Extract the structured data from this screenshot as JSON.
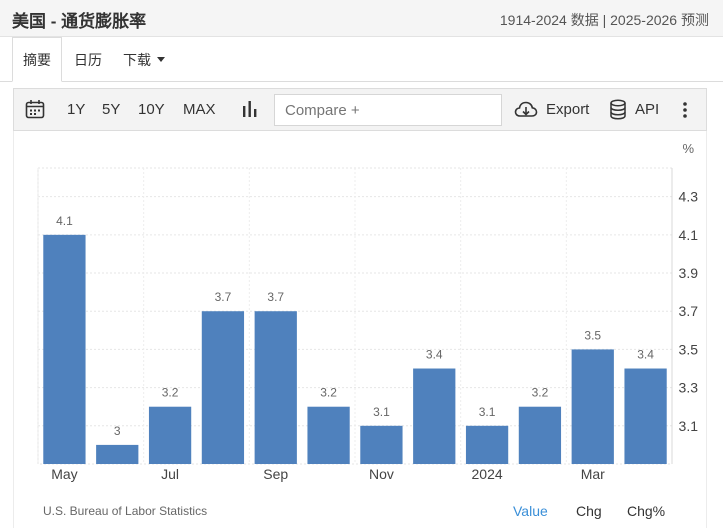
{
  "header": {
    "title": "美国 - 通货膨胀率",
    "range": "1914-2024 数据 | 2025-2026 预测"
  },
  "tabs": [
    {
      "label": "摘要",
      "active": true
    },
    {
      "label": "日历",
      "active": false
    },
    {
      "label": "下载",
      "active": false,
      "dropdown": true
    }
  ],
  "toolbar": {
    "periods": [
      "1Y",
      "5Y",
      "10Y",
      "MAX"
    ],
    "compare_placeholder": "Compare +",
    "export_label": "Export",
    "api_label": "API"
  },
  "chart_data": {
    "type": "bar",
    "unit_label": "%",
    "categories": [
      "2023-05",
      "2023-06",
      "2023-07",
      "2023-08",
      "2023-09",
      "2023-10",
      "2023-11",
      "2023-12",
      "2024-01",
      "2024-02",
      "2024-03",
      "2024-04"
    ],
    "values": [
      4.1,
      3.0,
      3.2,
      3.7,
      3.7,
      3.2,
      3.1,
      3.4,
      3.1,
      3.2,
      3.5,
      3.4
    ],
    "data_labels": [
      "4.1",
      "3",
      "3.2",
      "3.7",
      "3.7",
      "3.2",
      "3.1",
      "3.4",
      "3.1",
      "3.2",
      "3.5",
      "3.4"
    ],
    "x_tick_labels": [
      {
        "index": 0,
        "label": "May"
      },
      {
        "index": 2,
        "label": "Jul"
      },
      {
        "index": 4,
        "label": "Sep"
      },
      {
        "index": 6,
        "label": "Nov"
      },
      {
        "index": 8,
        "label": "2024"
      },
      {
        "index": 10,
        "label": "Mar"
      }
    ],
    "y_ticks": [
      3.1,
      3.3,
      3.5,
      3.7,
      3.9,
      4.1,
      4.3
    ],
    "y_tick_labels": [
      "3.1",
      "3.3",
      "3.5",
      "3.7",
      "3.9",
      "4.1",
      "4.3"
    ],
    "ylim": [
      2.9,
      4.45
    ],
    "grid": true,
    "bar_color": "#4f81bd",
    "source": "U.S. Bureau of Labor Statistics"
  },
  "view_modes": [
    {
      "label": "Value",
      "active": true
    },
    {
      "label": "Chg",
      "active": false
    },
    {
      "label": "Chg%",
      "active": false
    }
  ],
  "colors": {
    "accent": "#3a8fd8",
    "bar": "#4f81bd"
  }
}
